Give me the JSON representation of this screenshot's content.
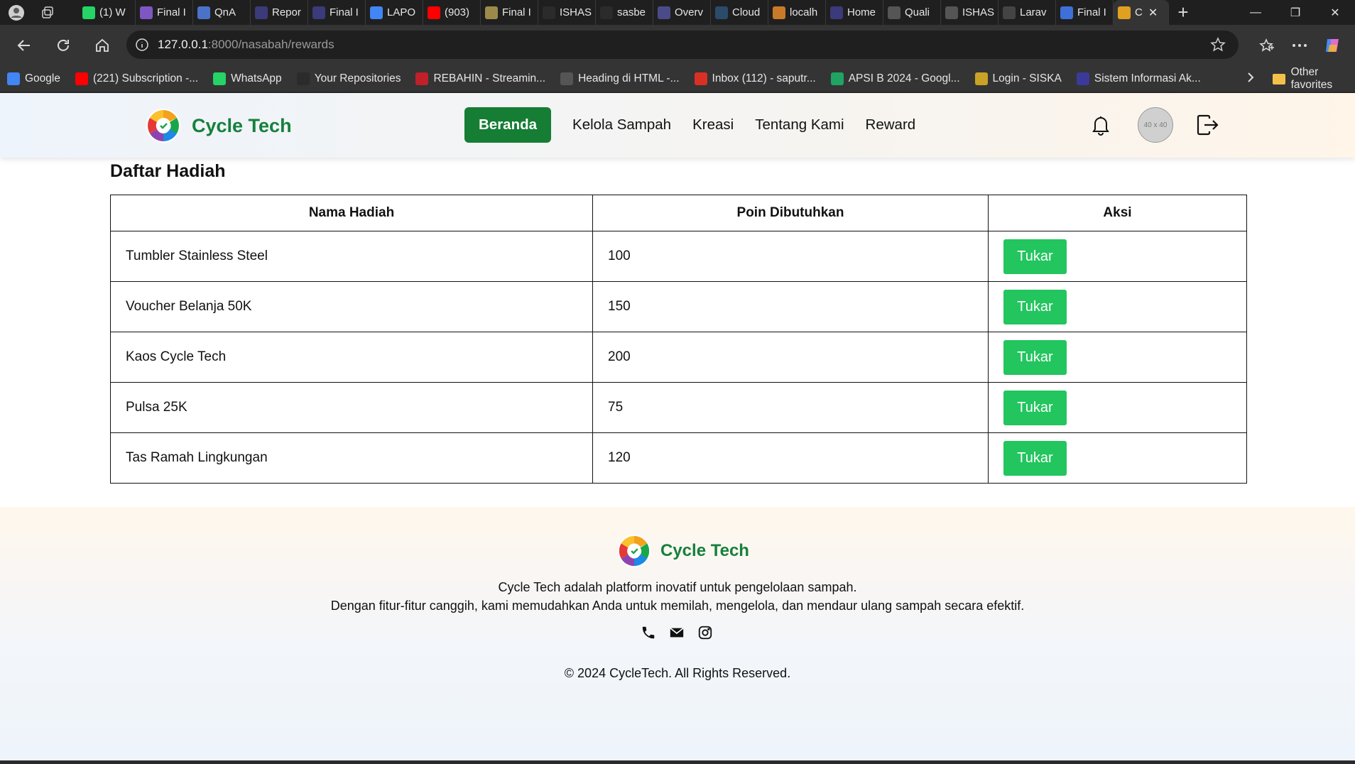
{
  "browser": {
    "tabs": [
      {
        "label": "(1) W",
        "icon": "whatsapp-icon",
        "color": "#25d366"
      },
      {
        "label": "Final I",
        "icon": "forms-icon",
        "color": "#7e57c2"
      },
      {
        "label": "QnA",
        "icon": "docs-icon",
        "color": "#4a72c8"
      },
      {
        "label": "Repor",
        "icon": "heart-icon",
        "color": "#3b3a7a"
      },
      {
        "label": "Final I",
        "icon": "heart-icon",
        "color": "#3b3a7a"
      },
      {
        "label": "LAPO",
        "icon": "docs-icon",
        "color": "#4285f4"
      },
      {
        "label": "(903)",
        "icon": "youtube-icon",
        "color": "#ff0000"
      },
      {
        "label": "Final I",
        "icon": "image-icon",
        "color": "#9c8a4b"
      },
      {
        "label": "ISHAS",
        "icon": "github-icon",
        "color": "#2b2b2b"
      },
      {
        "label": "sasbe",
        "icon": "github-icon",
        "color": "#2b2b2b"
      },
      {
        "label": "Overv",
        "icon": "dashboard-icon",
        "color": "#4b4b8a"
      },
      {
        "label": "Cloud",
        "icon": "cloud-icon",
        "color": "#2b4b6b"
      },
      {
        "label": "localh",
        "icon": "warning-icon",
        "color": "#c87a2a"
      },
      {
        "label": "Home",
        "icon": "heart-icon",
        "color": "#3b3a7a"
      },
      {
        "label": "Quali",
        "icon": "chart-icon",
        "color": "#555555"
      },
      {
        "label": "ISHAS",
        "icon": "chart-icon",
        "color": "#555555"
      },
      {
        "label": "Larav",
        "icon": "openai-icon",
        "color": "#444444"
      },
      {
        "label": "Final I",
        "icon": "copilot-icon",
        "color": "#3f6fd8"
      },
      {
        "label": "C",
        "icon": "cycletech-icon",
        "color": "#e0a020"
      }
    ],
    "url": {
      "host": "127.0.0.1",
      "rest": ":8000/nasabah/rewards"
    },
    "bookmarks": [
      {
        "label": "Google",
        "icon": "google-icon",
        "color": "#4285f4"
      },
      {
        "label": "(221) Subscription -...",
        "icon": "youtube-icon",
        "color": "#ff0000"
      },
      {
        "label": "WhatsApp",
        "icon": "whatsapp-icon",
        "color": "#25d366"
      },
      {
        "label": "Your Repositories",
        "icon": "github-icon",
        "color": "#2b2b2b"
      },
      {
        "label": "REBAHIN - Streamin...",
        "icon": "rebahin-icon",
        "color": "#c0202a"
      },
      {
        "label": "Heading di HTML -...",
        "icon": "page-icon",
        "color": "#555555"
      },
      {
        "label": "Inbox (112) - saputr...",
        "icon": "gmail-icon",
        "color": "#d93025"
      },
      {
        "label": "APSI B 2024 - Googl...",
        "icon": "drive-icon",
        "color": "#1fa463"
      },
      {
        "label": "Login - SISKA",
        "icon": "siska-icon",
        "color": "#c9a227"
      },
      {
        "label": "Sistem Informasi Ak...",
        "icon": "siakad-icon",
        "color": "#3b3a9a"
      }
    ],
    "other_favorites": "Other favorites"
  },
  "header": {
    "brand": "Cycle Tech",
    "nav": [
      {
        "label": "Beranda",
        "active": true
      },
      {
        "label": "Kelola Sampah",
        "active": false
      },
      {
        "label": "Kreasi",
        "active": false
      },
      {
        "label": "Tentang Kami",
        "active": false
      },
      {
        "label": "Reward",
        "active": false
      }
    ],
    "avatar_placeholder": "40 x 40"
  },
  "rewards": {
    "title": "Daftar Hadiah",
    "columns": [
      "Nama Hadiah",
      "Poin Dibutuhkan",
      "Aksi"
    ],
    "rows": [
      {
        "name": "Tumbler Stainless Steel",
        "points": "100",
        "action": "Tukar"
      },
      {
        "name": "Voucher Belanja 50K",
        "points": "150",
        "action": "Tukar"
      },
      {
        "name": "Kaos Cycle Tech",
        "points": "200",
        "action": "Tukar"
      },
      {
        "name": "Pulsa 25K",
        "points": "75",
        "action": "Tukar"
      },
      {
        "name": "Tas Ramah Lingkungan",
        "points": "120",
        "action": "Tukar"
      }
    ]
  },
  "footer": {
    "brand": "Cycle Tech",
    "description_line1": "Cycle Tech adalah platform inovatif untuk pengelolaan sampah.",
    "description_line2": "Dengan fitur-fitur canggih, kami memudahkan Anda untuk memilah, mengelola, dan mendaur ulang sampah secara efektif.",
    "social": [
      "phone-icon",
      "mail-icon",
      "instagram-icon"
    ],
    "copyright": "© 2024 CycleTech. All Rights Reserved."
  },
  "colors": {
    "brand_green": "#16803c",
    "nav_active_bg": "#157d34",
    "button_green": "#22c55e"
  }
}
